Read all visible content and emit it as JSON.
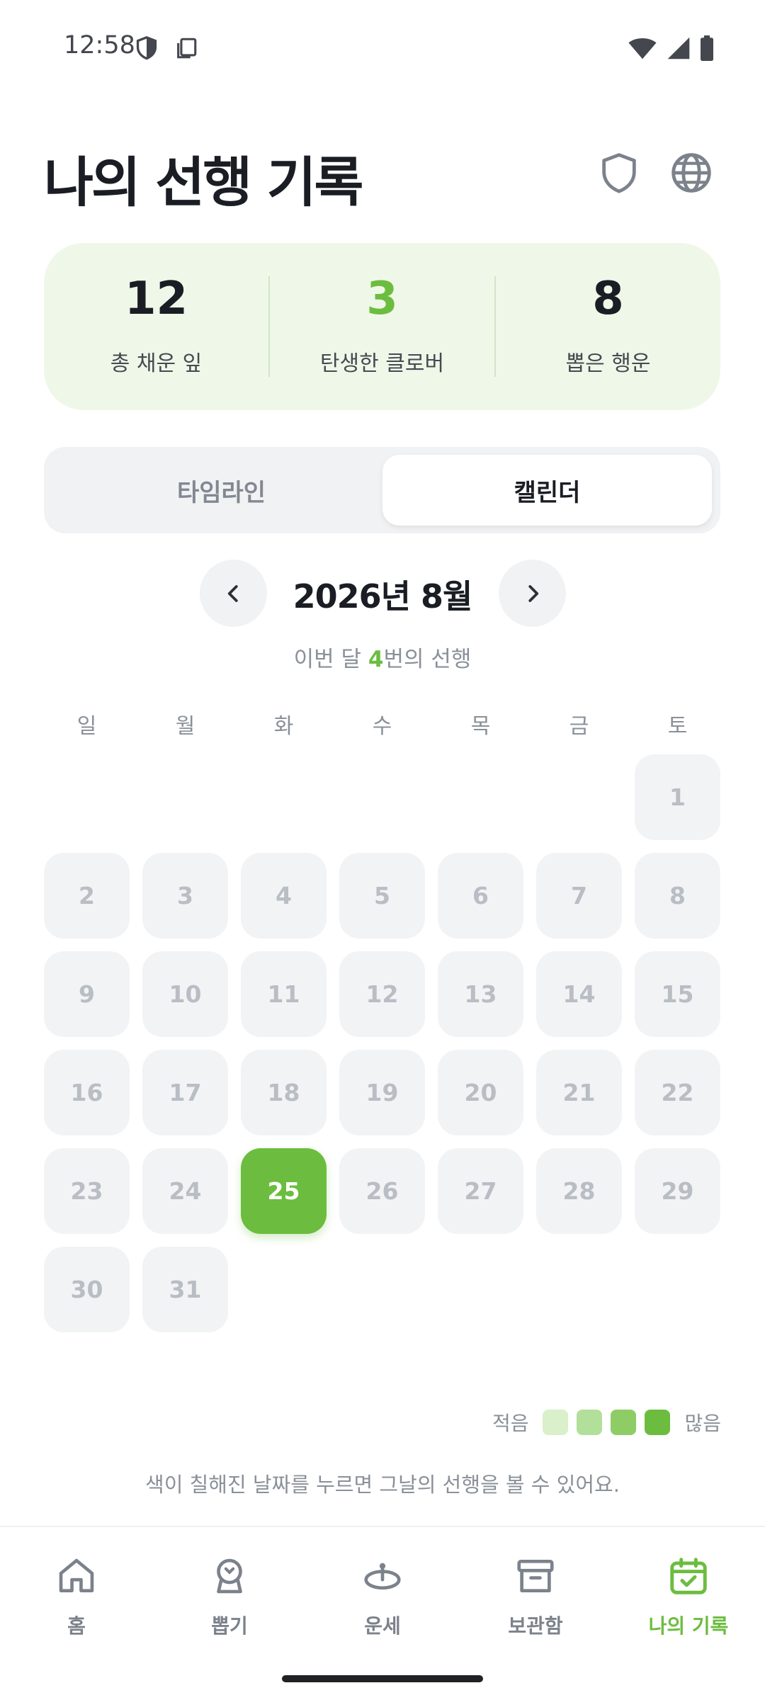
{
  "status_bar": {
    "time": "12:58",
    "left_icons": [
      "shield-icon",
      "screenshot-icon"
    ],
    "right_icons": [
      "wifi-icon",
      "signal-icon",
      "battery-icon"
    ]
  },
  "header": {
    "title": "나의 선행 기록",
    "icons": [
      "shield-icon",
      "globe-icon"
    ]
  },
  "stats": [
    {
      "value": "12",
      "label": "총 채운 잎"
    },
    {
      "value": "3",
      "label": "탄생한 클로버"
    },
    {
      "value": "8",
      "label": "뽑은 행운"
    }
  ],
  "tabs": [
    {
      "label": "타임라인",
      "selected": false
    },
    {
      "label": "캘린더",
      "selected": true
    }
  ],
  "calendar": {
    "month_title": "2026년 8월",
    "summary_prefix": "이번 달 ",
    "summary_count": "4",
    "summary_suffix": "번의 선행",
    "weekdays": [
      "일",
      "월",
      "화",
      "수",
      "목",
      "금",
      "토"
    ],
    "days": [
      "1",
      "2",
      "3",
      "4",
      "5",
      "6",
      "7",
      "8",
      "9",
      "10",
      "11",
      "12",
      "13",
      "14",
      "15",
      "16",
      "17",
      "18",
      "19",
      "20",
      "21",
      "22",
      "23",
      "24",
      "25",
      "26",
      "27",
      "28",
      "29",
      "30",
      "31"
    ],
    "selected_day": "25"
  },
  "legend": {
    "low_label": "적음",
    "high_label": "많음",
    "colors": [
      "#d9f0cb",
      "#b2e09a",
      "#8ecd66",
      "#6cbd3f"
    ]
  },
  "hint": "색이 칠해진 날짜를 누르면 그날의 선행을 볼 수 있어요.",
  "bottom_nav": [
    {
      "label": "홈",
      "icon": "home-icon",
      "active": false
    },
    {
      "label": "뽑기",
      "icon": "claw-machine-icon",
      "active": false
    },
    {
      "label": "운세",
      "icon": "fortune-icon",
      "active": false
    },
    {
      "label": "보관함",
      "icon": "archive-icon",
      "active": false
    },
    {
      "label": "나의 기록",
      "icon": "calendar-check-icon",
      "active": true
    }
  ],
  "colors": {
    "accent": "#6cbd3f",
    "stats_bg": "#eff8e8",
    "cell_bg": "#f2f3f5",
    "text_primary": "#1a1d23",
    "text_muted": "#8a9098"
  }
}
